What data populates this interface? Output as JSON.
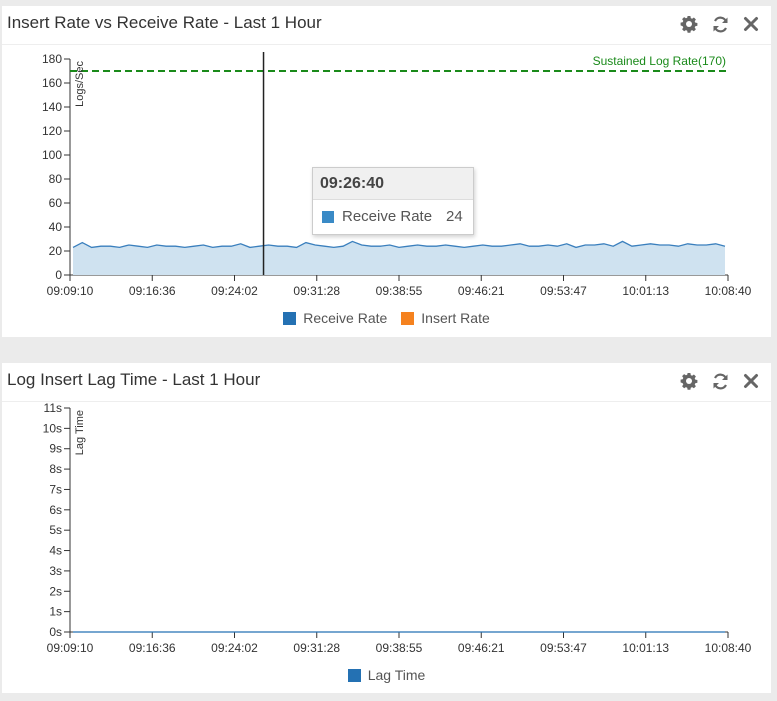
{
  "colors": {
    "receive": "#2471b3",
    "receive_line": "#3a7fbd",
    "receive_fill": "#cfe2f0",
    "insert": "#f5821f",
    "sustained": "#1a8a1a",
    "lag": "#2471b3"
  },
  "icons": [
    "gear-icon",
    "refresh-icon",
    "close-icon"
  ],
  "widget1": {
    "title": "Insert Rate vs Receive Rate - Last 1 Hour",
    "tooltip": {
      "time": "09:26:40",
      "series": "Receive Rate",
      "value": "24"
    },
    "legend": [
      "Receive Rate",
      "Insert Rate"
    ]
  },
  "widget2": {
    "title": "Log Insert Lag Time - Last 1 Hour",
    "legend": [
      "Lag Time"
    ]
  },
  "chart_data": [
    {
      "type": "area",
      "title": "Insert Rate vs Receive Rate - Last 1 Hour",
      "ylabel": "Logs/Sec",
      "xlabel": "",
      "ylim": [
        0,
        180
      ],
      "yticks": [
        "0",
        "20",
        "40",
        "60",
        "80",
        "100",
        "120",
        "140",
        "160",
        "180"
      ],
      "xticks": [
        "09:09:10",
        "09:16:36",
        "09:24:02",
        "09:31:28",
        "09:38:55",
        "09:46:21",
        "09:53:47",
        "10:01:13",
        "10:08:40"
      ],
      "series": [
        {
          "name": "Receive Rate",
          "values": [
            23,
            27,
            23,
            24,
            24,
            23,
            25,
            24,
            23,
            25,
            24,
            24,
            23,
            24,
            25,
            23,
            24,
            24,
            26,
            23,
            24,
            25,
            24,
            24,
            23,
            27,
            25,
            24,
            23,
            24,
            28,
            25,
            24,
            24,
            25,
            23,
            24,
            25,
            24,
            24,
            25,
            24,
            23,
            24,
            25,
            24,
            24,
            25,
            26,
            24,
            24,
            25,
            24,
            26,
            23,
            25,
            25,
            26,
            24,
            28,
            24,
            25,
            26,
            25,
            25,
            24,
            26,
            25,
            25,
            26,
            24
          ]
        },
        {
          "name": "Insert Rate",
          "values": []
        }
      ],
      "reference_line": {
        "label": "Sustained Log Rate(170)",
        "value": 170
      },
      "cursor": {
        "time": "09:26:40"
      },
      "grid": false,
      "legend_position": "bottom"
    },
    {
      "type": "line",
      "title": "Log Insert Lag Time - Last 1 Hour",
      "ylabel": "Lag Time",
      "xlabel": "",
      "ylim": [
        0,
        11
      ],
      "yticks": [
        "0s",
        "1s",
        "2s",
        "3s",
        "4s",
        "5s",
        "6s",
        "7s",
        "8s",
        "9s",
        "10s",
        "11s"
      ],
      "xticks": [
        "09:09:10",
        "09:16:36",
        "09:24:02",
        "09:31:28",
        "09:38:55",
        "09:46:21",
        "09:53:47",
        "10:01:13",
        "10:08:40"
      ],
      "series": [
        {
          "name": "Lag Time",
          "values": [
            0,
            0,
            0,
            0,
            0,
            0,
            0,
            0,
            0,
            0,
            0
          ]
        }
      ],
      "grid": false,
      "legend_position": "bottom"
    }
  ]
}
